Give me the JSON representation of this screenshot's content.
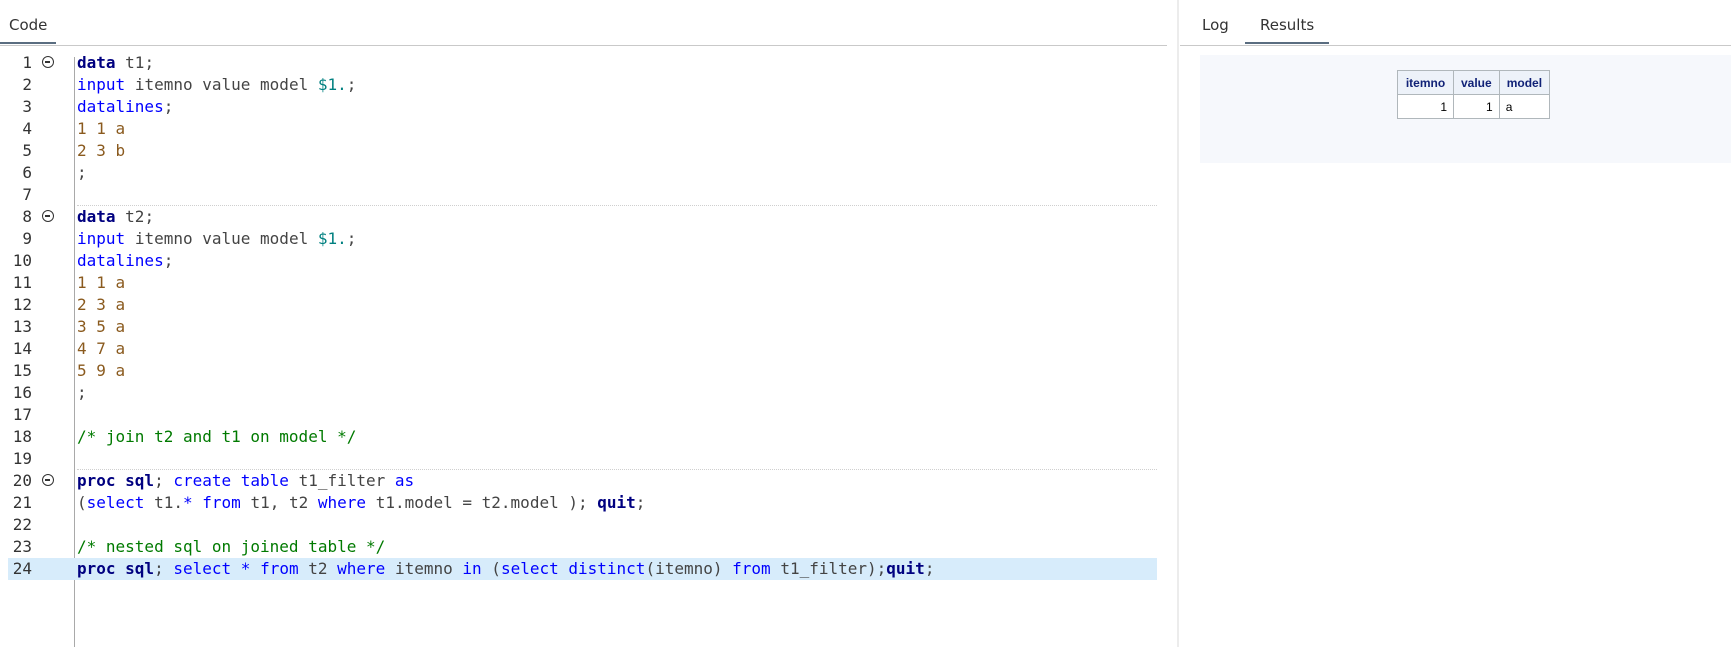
{
  "left_tabs": [
    {
      "label": "Code",
      "active": true
    }
  ],
  "right_tabs": [
    {
      "label": "Log",
      "active": false
    },
    {
      "label": "Results",
      "active": true
    }
  ],
  "editor": {
    "current_line": 24,
    "lines": [
      {
        "num": "1",
        "fold": true,
        "code": "<span class=\"kw\">data</span> <span class=\"tx\">t1;</span>"
      },
      {
        "num": "2",
        "fold": false,
        "code": "<span class=\"kb\">input</span> <span class=\"tx\">itemno value model</span> <span class=\"fmt\">$1.</span><span class=\"tx\">;</span>"
      },
      {
        "num": "3",
        "fold": false,
        "code": "<span class=\"kb\">datalines</span><span class=\"tx\">;</span>"
      },
      {
        "num": "4",
        "fold": false,
        "code": "<span class=\"dl\">1 1 a</span>"
      },
      {
        "num": "5",
        "fold": false,
        "code": "<span class=\"dl\">2 3 b</span>"
      },
      {
        "num": "6",
        "fold": false,
        "code": "<span class=\"tx\">;</span>"
      },
      {
        "num": "7",
        "fold": false,
        "code": ""
      },
      {
        "num": "8",
        "fold": true,
        "code": "<span class=\"kw\">data</span> <span class=\"tx\">t2;</span>"
      },
      {
        "num": "9",
        "fold": false,
        "code": "<span class=\"kb\">input</span> <span class=\"tx\">itemno value model</span> <span class=\"fmt\">$1.</span><span class=\"tx\">;</span>"
      },
      {
        "num": "10",
        "fold": false,
        "code": "<span class=\"kb\">datalines</span><span class=\"tx\">;</span>"
      },
      {
        "num": "11",
        "fold": false,
        "code": "<span class=\"dl\">1 1 a</span>"
      },
      {
        "num": "12",
        "fold": false,
        "code": "<span class=\"dl\">2 3 a</span>"
      },
      {
        "num": "13",
        "fold": false,
        "code": "<span class=\"dl\">3 5 a</span>"
      },
      {
        "num": "14",
        "fold": false,
        "code": "<span class=\"dl\">4 7 a</span>"
      },
      {
        "num": "15",
        "fold": false,
        "code": "<span class=\"dl\">5 9 a</span>"
      },
      {
        "num": "16",
        "fold": false,
        "code": "<span class=\"tx\">;</span>"
      },
      {
        "num": "17",
        "fold": false,
        "code": ""
      },
      {
        "num": "18",
        "fold": false,
        "code": "<span class=\"cm\">/* join t2 and t1 on model */</span>"
      },
      {
        "num": "19",
        "fold": false,
        "code": ""
      },
      {
        "num": "20",
        "fold": true,
        "code": "<span class=\"kw\">proc sql</span><span class=\"tx\">;</span> <span class=\"kb\">create table</span> <span class=\"tx\">t1_filter</span> <span class=\"kb\">as</span>"
      },
      {
        "num": "21",
        "fold": false,
        "code": "<span class=\"tx\">(</span><span class=\"kb\">select</span> <span class=\"tx\">t1.</span><span class=\"kb\">*</span> <span class=\"kb\">from</span> <span class=\"tx\">t1, t2</span> <span class=\"kb\">where</span> <span class=\"tx\">t1.model = t2.model );</span> <span class=\"kw\">quit</span><span class=\"tx\">;</span>"
      },
      {
        "num": "22",
        "fold": false,
        "code": ""
      },
      {
        "num": "23",
        "fold": false,
        "code": "<span class=\"cm\">/* nested sql on joined table */</span>"
      },
      {
        "num": "24",
        "fold": false,
        "code": "<span class=\"kw\">proc sql</span><span class=\"tx\">;</span> <span class=\"kb\">select</span> <span class=\"kb\">*</span> <span class=\"kb\">from</span> <span class=\"tx\">t2</span> <span class=\"kb\">where</span> <span class=\"tx\">itemno</span> <span class=\"kb\">in</span> <span class=\"tx\">(</span><span class=\"kb\">select distinct</span><span class=\"tx\">(itemno)</span> <span class=\"kb\">from</span> <span class=\"tx\">t1_filter);</span><span class=\"kw\">quit</span><span class=\"tx\">;</span>"
      }
    ]
  },
  "results_table": {
    "columns": [
      "itemno",
      "value",
      "model"
    ],
    "rows": [
      [
        "1",
        "1",
        "a"
      ]
    ]
  }
}
